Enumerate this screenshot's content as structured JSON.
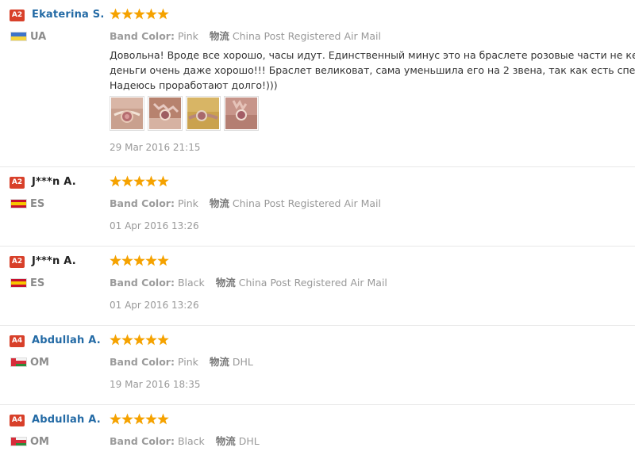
{
  "labels": {
    "band_color": "Band Color:",
    "shipping": "物流"
  },
  "colors": {
    "badge": "#d8402a",
    "name_blue": "#236aa5",
    "name_black": "#222222",
    "star": "#f5a200"
  },
  "reviews": [
    {
      "level": "A2",
      "name": "Ekaterina S.",
      "country": "UA",
      "flag": "flag-ua-icon",
      "rating": 5,
      "band_color": "Pink",
      "shipping_method": "China Post Registered Air Mail",
      "comment_lines": [
        "Довольна! Вроде все хорошо, часы идут. Единственный минус это на браслете розовые части не керамика",
        "деньги очень даже хорошо!!! Браслет великоват, сама уменьшила его на 2 звена, так как есть специальны",
        "Надеюсь проработают долго!)))"
      ],
      "photos": [
        "photo-1",
        "photo-2",
        "photo-3",
        "photo-4"
      ],
      "date": "29 Mar 2016 21:15"
    },
    {
      "level": "A2",
      "name": "J***n A.",
      "country": "ES",
      "flag": "flag-es-icon",
      "rating": 5,
      "band_color": "Pink",
      "shipping_method": "China Post Registered Air Mail",
      "date": "01 Apr 2016 13:26"
    },
    {
      "level": "A2",
      "name": "J***n A.",
      "country": "ES",
      "flag": "flag-es-icon",
      "rating": 5,
      "band_color": "Black",
      "shipping_method": "China Post Registered Air Mail",
      "date": "01 Apr 2016 13:26"
    },
    {
      "level": "A4",
      "name": "Abdullah A.",
      "country": "OM",
      "flag": "flag-om-icon",
      "rating": 5,
      "band_color": "Pink",
      "shipping_method": "DHL",
      "date": "19 Mar 2016 18:35"
    },
    {
      "level": "A4",
      "name": "Abdullah A.",
      "country": "OM",
      "flag": "flag-om-icon",
      "rating": 5,
      "band_color": "Black",
      "shipping_method": "DHL"
    }
  ]
}
